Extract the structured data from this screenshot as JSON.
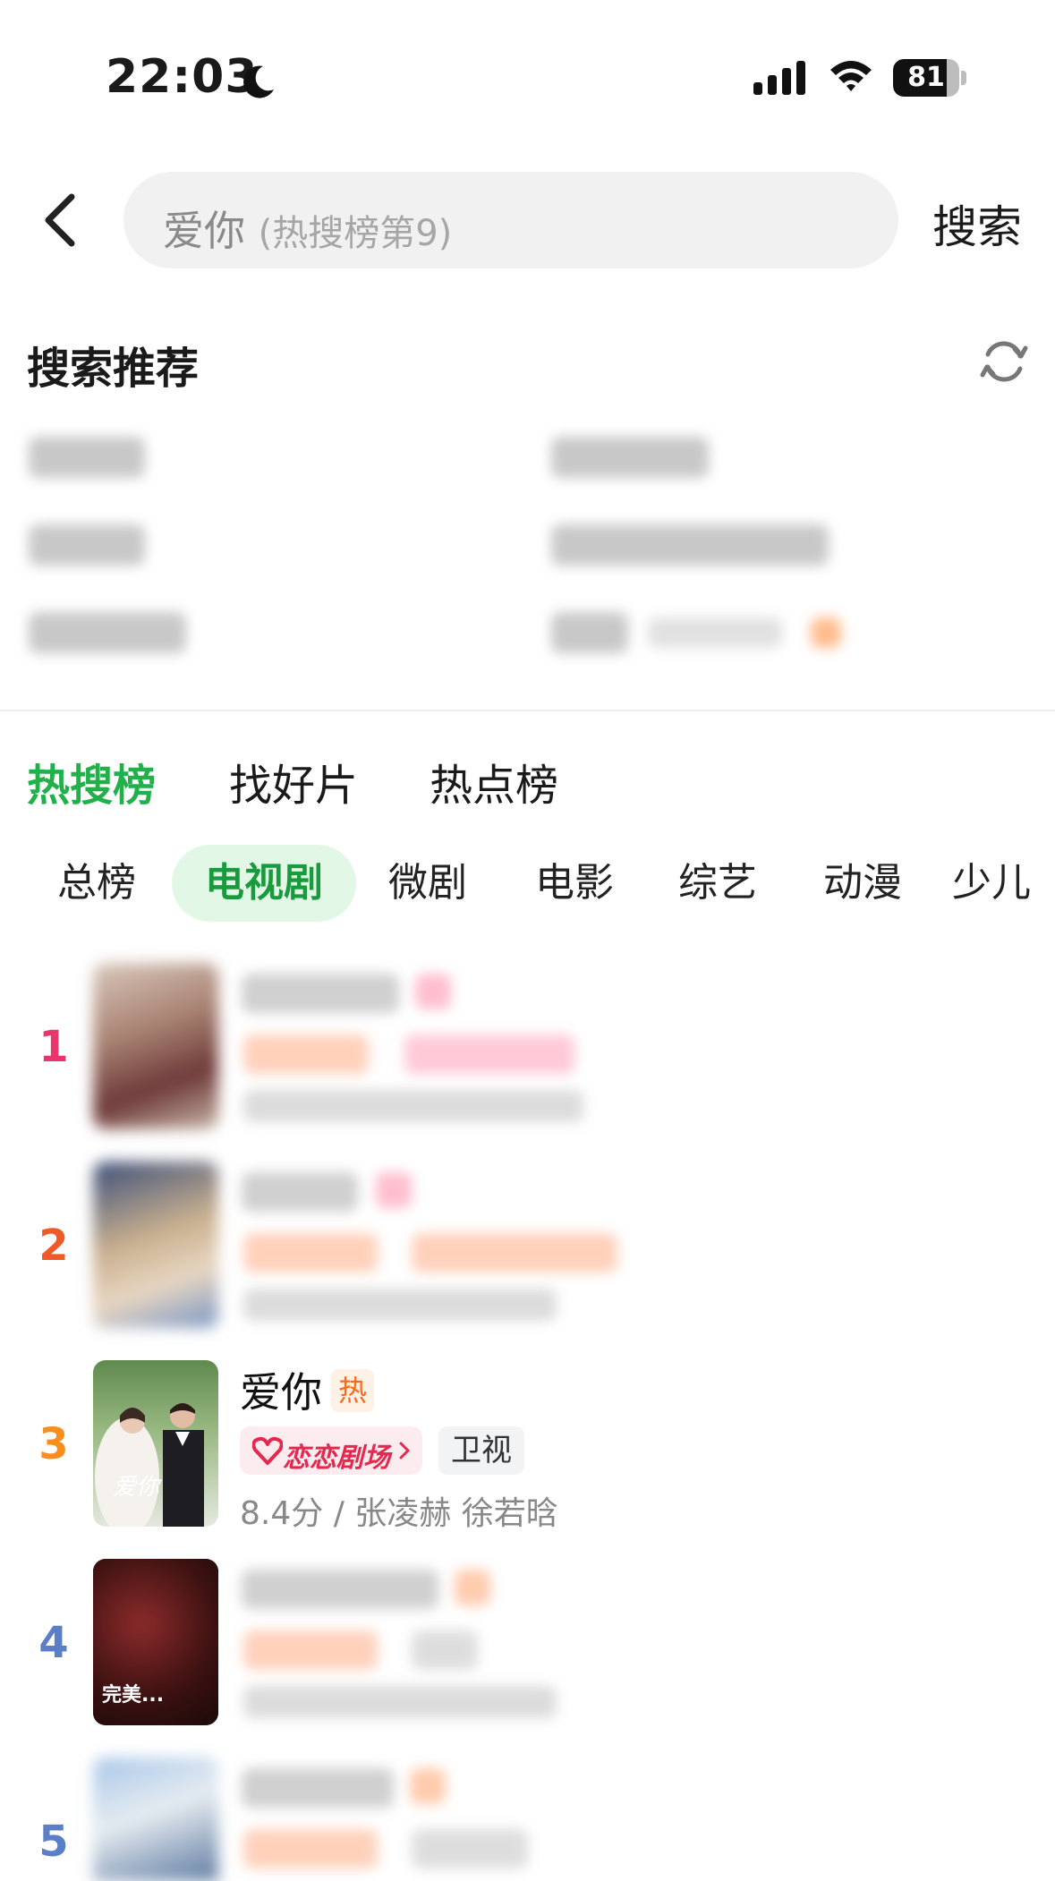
{
  "status_bar": {
    "time": "22:03",
    "battery": "81",
    "battery_level": 0.81
  },
  "search": {
    "query": "爱你",
    "hint": "(热搜榜第9)",
    "button_label": "搜索"
  },
  "recommend": {
    "title": "搜索推荐"
  },
  "chart_tabs": [
    {
      "label": "热搜榜",
      "active": true
    },
    {
      "label": "找好片",
      "active": false
    },
    {
      "label": "热点榜",
      "active": false
    }
  ],
  "categories": [
    {
      "label": "总榜",
      "active": false
    },
    {
      "label": "电视剧",
      "active": true
    },
    {
      "label": "微剧",
      "active": false
    },
    {
      "label": "电影",
      "active": false
    },
    {
      "label": "综艺",
      "active": false
    },
    {
      "label": "动漫",
      "active": false
    },
    {
      "label": "少儿",
      "active": false
    }
  ],
  "list": [
    {
      "rank": "1",
      "rank_color": "#e8356b",
      "blurred": true
    },
    {
      "rank": "2",
      "rank_color": "#f05a28",
      "blurred": true
    },
    {
      "rank": "3",
      "rank_color": "#f5901e",
      "blurred": false,
      "title": "爱你",
      "badge": "热",
      "channel_tag": "恋恋剧场",
      "tag": "卫视",
      "meta": "8.4分 / 张凌赫 徐若晗"
    },
    {
      "rank": "4",
      "rank_color": "#5b7fc7",
      "blurred": true,
      "poster_text": "完美..."
    },
    {
      "rank": "5",
      "rank_color": "#5b7fc7",
      "blurred": true
    }
  ],
  "colors": {
    "accent": "#22b04b",
    "hot": "#ff6a1a"
  },
  "icons": [
    "moon-icon",
    "signal-icon",
    "wifi-icon",
    "battery-icon",
    "back-arrow-icon",
    "refresh-icon",
    "heart-logo-icon",
    "chevron-right-icon"
  ]
}
